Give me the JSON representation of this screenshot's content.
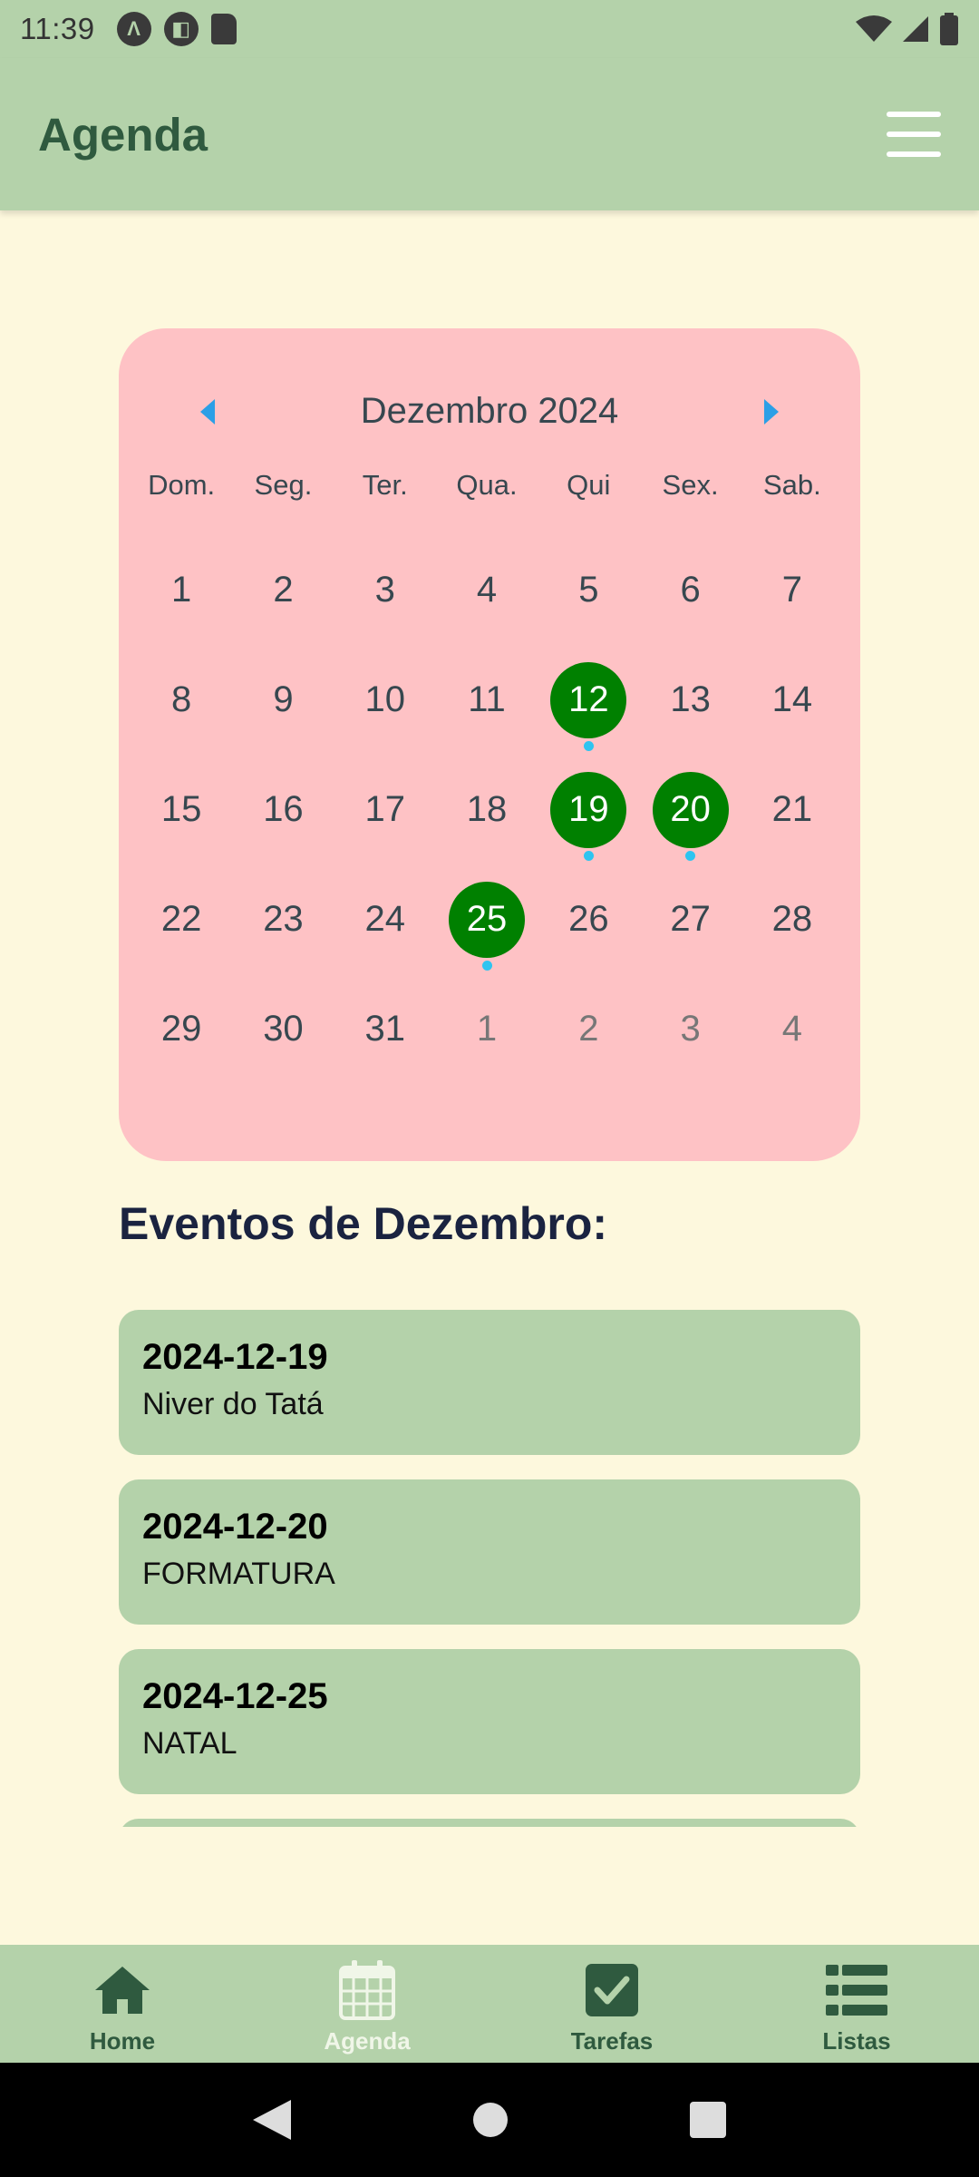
{
  "status_bar": {
    "time": "11:39"
  },
  "app_bar": {
    "title": "Agenda"
  },
  "calendar": {
    "month_title": "Dezembro 2024",
    "weekdays": [
      "Dom.",
      "Seg.",
      "Ter.",
      "Qua.",
      "Qui",
      "Sex.",
      "Sab."
    ],
    "days": [
      {
        "label": "1",
        "outside": false,
        "event": false
      },
      {
        "label": "2",
        "outside": false,
        "event": false
      },
      {
        "label": "3",
        "outside": false,
        "event": false
      },
      {
        "label": "4",
        "outside": false,
        "event": false
      },
      {
        "label": "5",
        "outside": false,
        "event": false
      },
      {
        "label": "6",
        "outside": false,
        "event": false
      },
      {
        "label": "7",
        "outside": false,
        "event": false
      },
      {
        "label": "8",
        "outside": false,
        "event": false
      },
      {
        "label": "9",
        "outside": false,
        "event": false
      },
      {
        "label": "10",
        "outside": false,
        "event": false
      },
      {
        "label": "11",
        "outside": false,
        "event": false
      },
      {
        "label": "12",
        "outside": false,
        "event": true
      },
      {
        "label": "13",
        "outside": false,
        "event": false
      },
      {
        "label": "14",
        "outside": false,
        "event": false
      },
      {
        "label": "15",
        "outside": false,
        "event": false
      },
      {
        "label": "16",
        "outside": false,
        "event": false
      },
      {
        "label": "17",
        "outside": false,
        "event": false
      },
      {
        "label": "18",
        "outside": false,
        "event": false
      },
      {
        "label": "19",
        "outside": false,
        "event": true
      },
      {
        "label": "20",
        "outside": false,
        "event": true
      },
      {
        "label": "21",
        "outside": false,
        "event": false
      },
      {
        "label": "22",
        "outside": false,
        "event": false
      },
      {
        "label": "23",
        "outside": false,
        "event": false
      },
      {
        "label": "24",
        "outside": false,
        "event": false
      },
      {
        "label": "25",
        "outside": false,
        "event": true
      },
      {
        "label": "26",
        "outside": false,
        "event": false
      },
      {
        "label": "27",
        "outside": false,
        "event": false
      },
      {
        "label": "28",
        "outside": false,
        "event": false
      },
      {
        "label": "29",
        "outside": false,
        "event": false
      },
      {
        "label": "30",
        "outside": false,
        "event": false
      },
      {
        "label": "31",
        "outside": false,
        "event": false
      },
      {
        "label": "1",
        "outside": true,
        "event": false
      },
      {
        "label": "2",
        "outside": true,
        "event": false
      },
      {
        "label": "3",
        "outside": true,
        "event": false
      },
      {
        "label": "4",
        "outside": true,
        "event": false
      }
    ]
  },
  "events": {
    "title": "Eventos de Dezembro:",
    "items": [
      {
        "date": "2024-12-19",
        "name": "Niver do Tatá"
      },
      {
        "date": "2024-12-20",
        "name": "FORMATURA"
      },
      {
        "date": "2024-12-25",
        "name": "NATAL"
      }
    ]
  },
  "bottom_nav": {
    "items": [
      {
        "label": "Home",
        "icon": "home-icon"
      },
      {
        "label": "Agenda",
        "icon": "calendar-icon"
      },
      {
        "label": "Tarefas",
        "icon": "checkbox-icon"
      },
      {
        "label": "Listas",
        "icon": "list-icon"
      }
    ],
    "active_index": 1
  },
  "colors": {
    "primary_green": "#b4d2aa",
    "dark_green": "#2f5a3f",
    "calendar_bg": "#fec2c5",
    "event_day": "#008000",
    "event_dot": "#2ec4f0",
    "page_bg": "#fdf8dd"
  }
}
